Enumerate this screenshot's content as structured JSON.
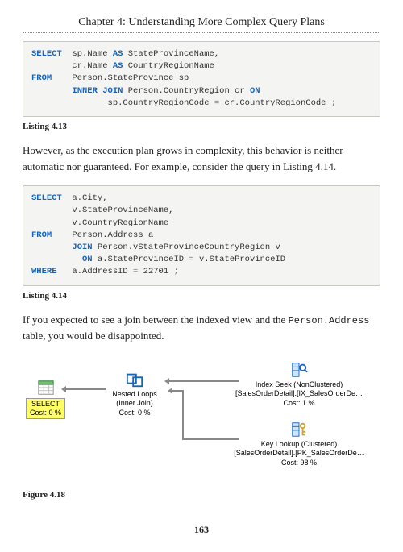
{
  "chapter_title": "Chapter 4: Understanding More Complex Query Plans",
  "listing413": {
    "label": "Listing 4.13",
    "l1a": "SELECT",
    "l1b": "  sp.Name ",
    "l1c": "AS",
    "l1d": " StateProvinceName,",
    "l2": "        cr.Name ",
    "l2b": "AS",
    "l2c": " CountryRegionName",
    "l3a": "FROM",
    "l3b": "    Person.StateProvince sp",
    "l4a": "        INNER JOIN",
    "l4b": " Person.CountryRegion cr ",
    "l4c": "ON",
    "l5a": "               sp.CountryRegionCode ",
    "l5b": "=",
    "l5c": " cr.CountryRegionCode ",
    "l5d": ";"
  },
  "para1": "However, as the execution plan grows in complexity, this behavior is neither automatic nor guaranteed. For example, consider the query in Listing 4.14.",
  "listing414": {
    "label": "Listing 4.14",
    "l1a": "SELECT",
    "l1b": "  a.City,",
    "l2": "        v.StateProvinceName,",
    "l3": "        v.CountryRegionName",
    "l4a": "FROM",
    "l4b": "    Person.Address a",
    "l5a": "        JOIN",
    "l5b": " Person.vStateProvinceCountryRegion v",
    "l6a": "          ON",
    "l6b": " a.StateProvinceID ",
    "l6c": "=",
    "l6d": " v.StateProvinceID",
    "l7a": "WHERE",
    "l7b": "   a.AddressID ",
    "l7c": "=",
    "l7d": " 22701 ",
    "l7e": ";"
  },
  "para2_a": "If you expected to see a join between the indexed view and the ",
  "para2_mono": "Person.Address",
  "para2_b": " table, you would be disappointed.",
  "plan": {
    "select_label": "SELECT",
    "select_cost": "Cost: 0 %",
    "nested_label": "Nested Loops",
    "nested_sub": "(Inner Join)",
    "nested_cost": "Cost: 0 %",
    "indexseek_label": "Index Seek (NonClustered)",
    "indexseek_sub": "[SalesOrderDetail].[IX_SalesOrderDe…",
    "indexseek_cost": "Cost: 1 %",
    "keylookup_label": "Key Lookup (Clustered)",
    "keylookup_sub": "[SalesOrderDetail].[PK_SalesOrderDe…",
    "keylookup_cost": "Cost: 98 %"
  },
  "figure_label": "Figure 4.18",
  "page_number": "163"
}
